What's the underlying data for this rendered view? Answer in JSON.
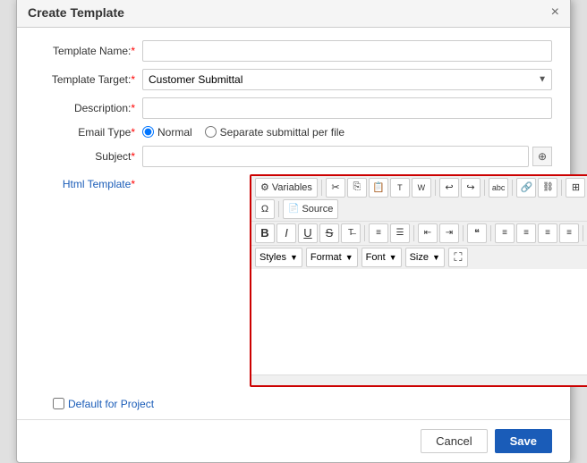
{
  "dialog": {
    "title": "Create Template",
    "close_label": "×"
  },
  "form": {
    "template_name_label": "Template Name:",
    "template_name_required": "*",
    "template_name_value": "",
    "template_target_label": "Template Target:",
    "template_target_required": "*",
    "template_target_value": "Customer Submittal",
    "description_label": "Description:",
    "description_required": "*",
    "email_type_label": "Email Type",
    "email_type_required": "*",
    "email_type_normal": "Normal",
    "email_type_separate": "Separate submittal per file",
    "subject_label": "Subject",
    "subject_required": "*",
    "subject_value": "",
    "html_template_label": "Html Template",
    "html_template_required": "*",
    "default_checkbox_label": "Default for Project"
  },
  "toolbar": {
    "variables_label": "Variables",
    "source_label": "Source",
    "styles_label": "Styles",
    "format_label": "Format",
    "font_label": "Font",
    "size_label": "Size"
  },
  "footer": {
    "cancel_label": "Cancel",
    "save_label": "Save"
  }
}
